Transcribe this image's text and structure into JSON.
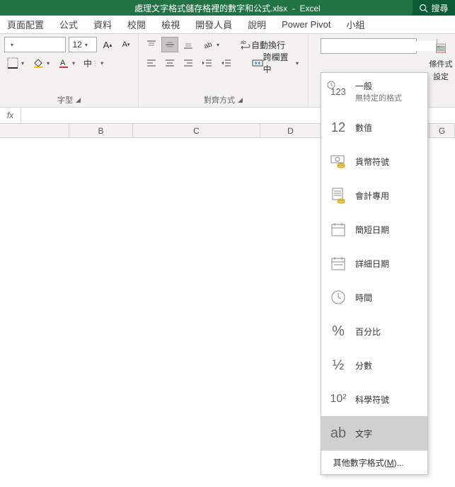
{
  "titlebar": {
    "filename": "處理文字格式儲存格裡的數字和公式.xlsx",
    "app": "Excel",
    "search_label": "搜尋"
  },
  "tabs": {
    "t1": "頁面配置",
    "t2": "公式",
    "t3": "資料",
    "t4": "校閱",
    "t5": "檢視",
    "t6": "開發人員",
    "t7": "說明",
    "t8": "Power Pivot",
    "t9": "小組"
  },
  "font": {
    "size": "12",
    "label": "字型",
    "zhong": "中"
  },
  "align": {
    "wrap": "自動換行",
    "merge": "跨欄置中",
    "label": "對齊方式"
  },
  "number_format": {
    "value": ""
  },
  "cond": {
    "line1": "條件式",
    "line2": "設定"
  },
  "fx": {
    "label": "fx"
  },
  "cols": {
    "b": "B",
    "c": "C",
    "d": "D",
    "g": "G"
  },
  "dd": {
    "i0": {
      "title": "一般",
      "sub": "無特定的格式",
      "glyph": "123"
    },
    "i1": {
      "title": "數值",
      "glyph": "12"
    },
    "i2": {
      "title": "貨幣符號"
    },
    "i3": {
      "title": "會計專用"
    },
    "i4": {
      "title": "簡短日期"
    },
    "i5": {
      "title": "詳細日期"
    },
    "i6": {
      "title": "時間"
    },
    "i7": {
      "title": "百分比",
      "glyph": "%"
    },
    "i8": {
      "title": "分數",
      "glyph": "½"
    },
    "i9": {
      "title": "科學符號",
      "glyph": "10²"
    },
    "i10": {
      "title": "文字",
      "glyph": "ab"
    },
    "footer_pre": "其他數字格式(",
    "footer_key": "M",
    "footer_post": ")..."
  }
}
